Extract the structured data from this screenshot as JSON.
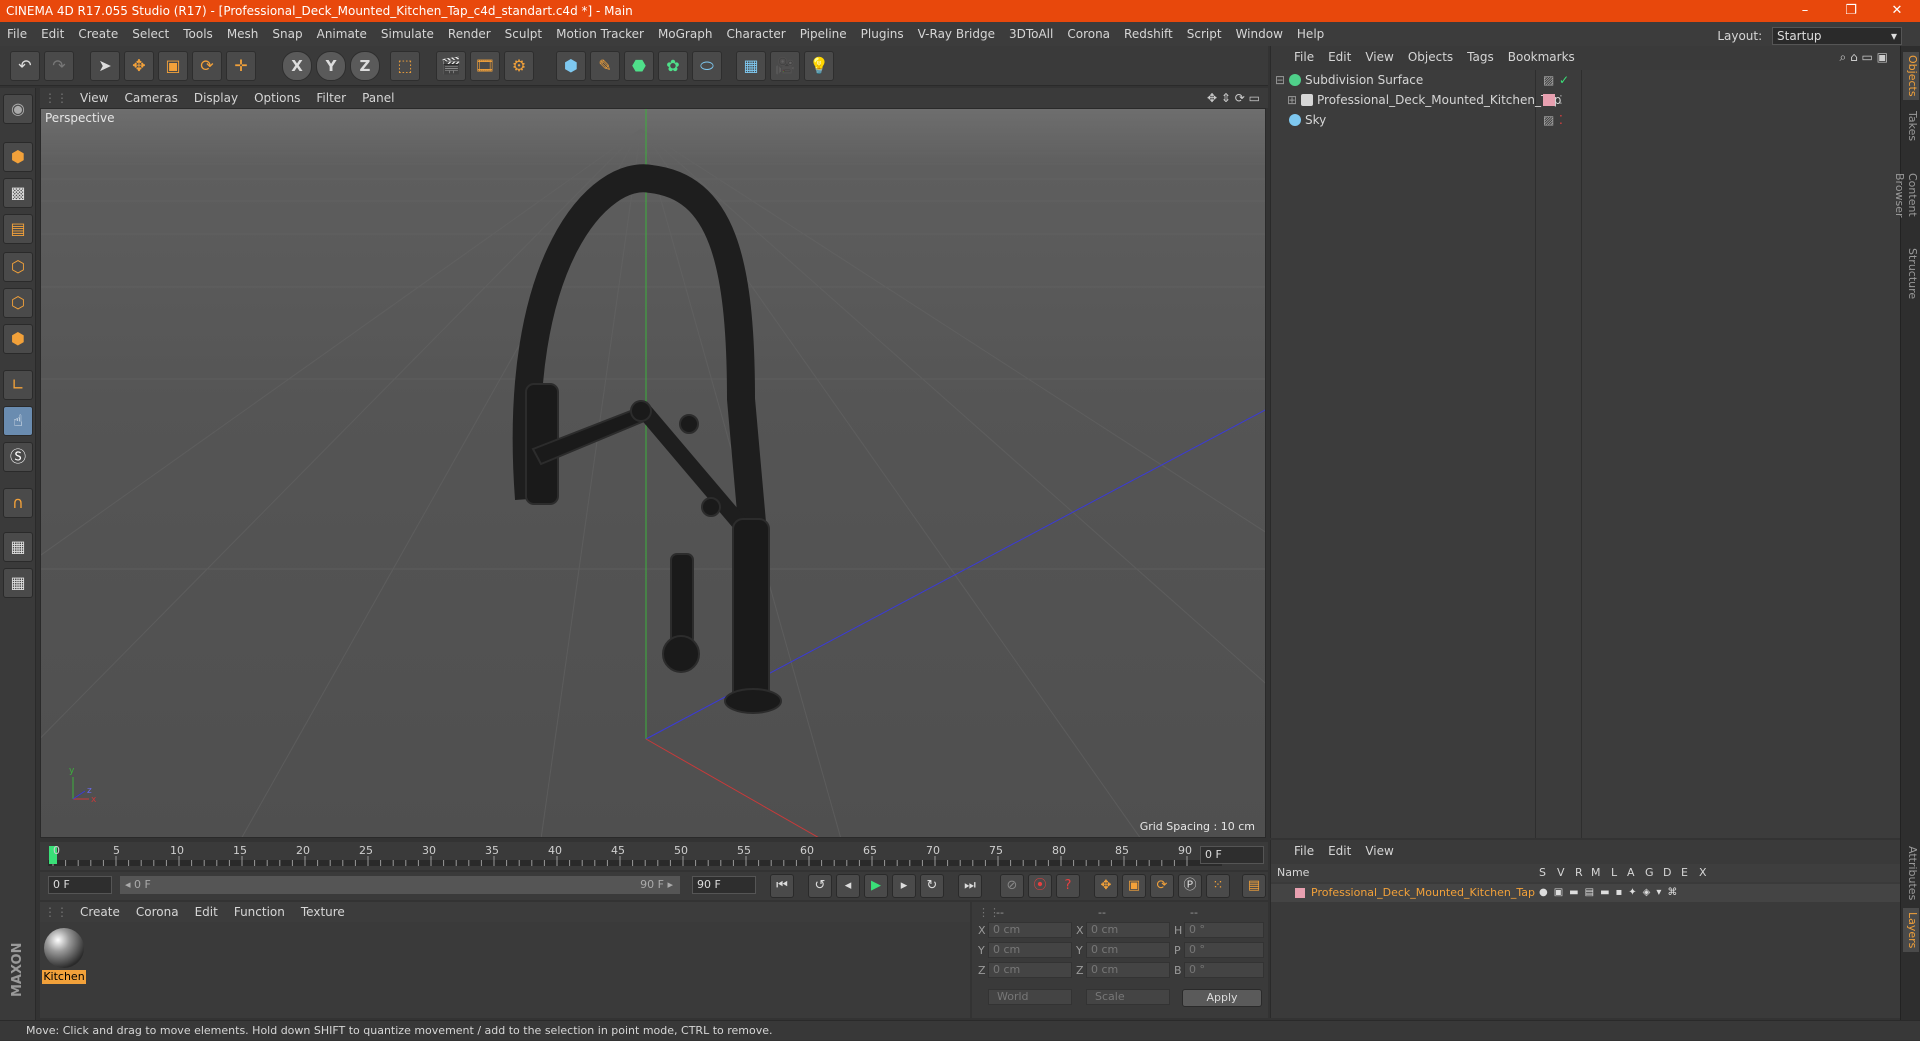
{
  "window": {
    "title": "CINEMA 4D R17.055 Studio (R17) - [Professional_Deck_Mounted_Kitchen_Tap_c4d_standart.c4d *] - Main",
    "controls": [
      "–",
      "❐",
      "✕"
    ]
  },
  "menubar": {
    "items": [
      "File",
      "Edit",
      "Create",
      "Select",
      "Tools",
      "Mesh",
      "Snap",
      "Animate",
      "Simulate",
      "Render",
      "Sculpt",
      "Motion Tracker",
      "MoGraph",
      "Character",
      "Pipeline",
      "Plugins",
      "V-Ray Bridge",
      "3DToAll",
      "Corona",
      "Redshift",
      "Script",
      "Window",
      "Help"
    ],
    "layout_label": "Layout:",
    "layout_value": "Startup"
  },
  "toolbar": {
    "buttons": [
      {
        "name": "undo-button",
        "glyph": "↶"
      },
      {
        "name": "redo-button",
        "glyph": "↷"
      },
      {
        "name": "select-tool-button",
        "glyph": "➤"
      },
      {
        "name": "move-tool-button",
        "glyph": "✥"
      },
      {
        "name": "scale-tool-button",
        "glyph": "▣"
      },
      {
        "name": "rotate-tool-button",
        "glyph": "⟳"
      },
      {
        "name": "transform-tool-button",
        "glyph": "✛"
      },
      {
        "name": "x-axis-button",
        "glyph": "X"
      },
      {
        "name": "y-axis-button",
        "glyph": "Y"
      },
      {
        "name": "z-axis-button",
        "glyph": "Z"
      },
      {
        "name": "coordinate-system-button",
        "glyph": "⬚"
      },
      {
        "name": "render-view-button",
        "glyph": "🎬"
      },
      {
        "name": "render-picture-viewer-button",
        "glyph": "🎞"
      },
      {
        "name": "render-settings-button",
        "glyph": "⚙"
      },
      {
        "name": "cube-object-button",
        "glyph": "⬢"
      },
      {
        "name": "spline-pen-button",
        "glyph": "✎"
      },
      {
        "name": "subdivision-surface-button",
        "glyph": "⬣"
      },
      {
        "name": "cloner-button",
        "glyph": "✿"
      },
      {
        "name": "deformer-button",
        "glyph": "⬭"
      },
      {
        "name": "floor-button",
        "glyph": "▦"
      },
      {
        "name": "camera-button",
        "glyph": "🎥"
      },
      {
        "name": "light-button",
        "glyph": "💡"
      }
    ]
  },
  "left_tools": {
    "buttons": [
      "make-editable-icon",
      "model-mode-icon",
      "texture-mode-icon",
      "workplane-icon",
      "points-mode-icon",
      "edges-mode-icon",
      "polygons-mode-icon",
      "axis-mode-icon",
      "tweak-mode-icon",
      "solo-mode-icon",
      "magnet-icon",
      "snap-grid-icon",
      "snap-lock-icon"
    ],
    "brand": "MAXON CINEMA 4D"
  },
  "viewport": {
    "menu": [
      "View",
      "Cameras",
      "Display",
      "Options",
      "Filter",
      "Panel"
    ],
    "label": "Perspective",
    "grid_spacing": "Grid Spacing : 10 cm"
  },
  "timeline": {
    "ticks": [
      "0",
      "5",
      "10",
      "15",
      "20",
      "25",
      "30",
      "35",
      "40",
      "45",
      "50",
      "55",
      "60",
      "65",
      "70",
      "75",
      "80",
      "85",
      "90"
    ],
    "current_frame": "0 F"
  },
  "time_controls": {
    "start_frame": "0 F",
    "range_start": "◂ 0 F",
    "range_end": "90 F ▸",
    "end_frame": "90 F"
  },
  "material_manager": {
    "menu": [
      "Create",
      "Corona",
      "Edit",
      "Function",
      "Texture"
    ],
    "materials": [
      {
        "name": "Kitchen"
      }
    ]
  },
  "coordinates": {
    "header": [
      "--",
      "--",
      "--"
    ],
    "rows": [
      {
        "axis": "X",
        "pos": "0 cm",
        "axis2": "X",
        "size": "0 cm",
        "rlabel": "H",
        "rot": "0 °"
      },
      {
        "axis": "Y",
        "pos": "0 cm",
        "axis2": "Y",
        "size": "0 cm",
        "rlabel": "P",
        "rot": "0 °"
      },
      {
        "axis": "Z",
        "pos": "0 cm",
        "axis2": "Z",
        "size": "0 cm",
        "rlabel": "B",
        "rot": "0 °"
      }
    ],
    "mode_world": "World",
    "mode_scale": "Scale",
    "apply": "Apply"
  },
  "object_manager": {
    "menu": [
      "File",
      "Edit",
      "View",
      "Objects",
      "Tags",
      "Bookmarks"
    ],
    "objects": [
      {
        "name": "Subdivision Surface",
        "icon_color": "#4fd08a"
      },
      {
        "name": "Professional_Deck_Mounted_Kitchen_Tap",
        "icon_color": "#d6d6d6"
      },
      {
        "name": "Sky",
        "icon_color": "#7ec8f0"
      }
    ]
  },
  "layer_manager": {
    "menu": [
      "File",
      "Edit",
      "View"
    ],
    "columns": [
      "Name",
      "S",
      "V",
      "R",
      "M",
      "L",
      "A",
      "G",
      "D",
      "E",
      "X"
    ],
    "layers": [
      {
        "name": "Professional_Deck_Mounted_Kitchen_Tap",
        "color": "#e8a0b0"
      }
    ]
  },
  "right_tabs": [
    "Objects",
    "Takes",
    "Content Browser",
    "Structure",
    "Attributes",
    "Layers"
  ],
  "status": {
    "text": "Move: Click and drag to move elements. Hold down SHIFT to quantize movement / add to the selection in point mode, CTRL to remove."
  },
  "colors": {
    "title_bar": "#e8480c",
    "accent": "#f2a13a",
    "highlight_text": "#f2a13a"
  }
}
